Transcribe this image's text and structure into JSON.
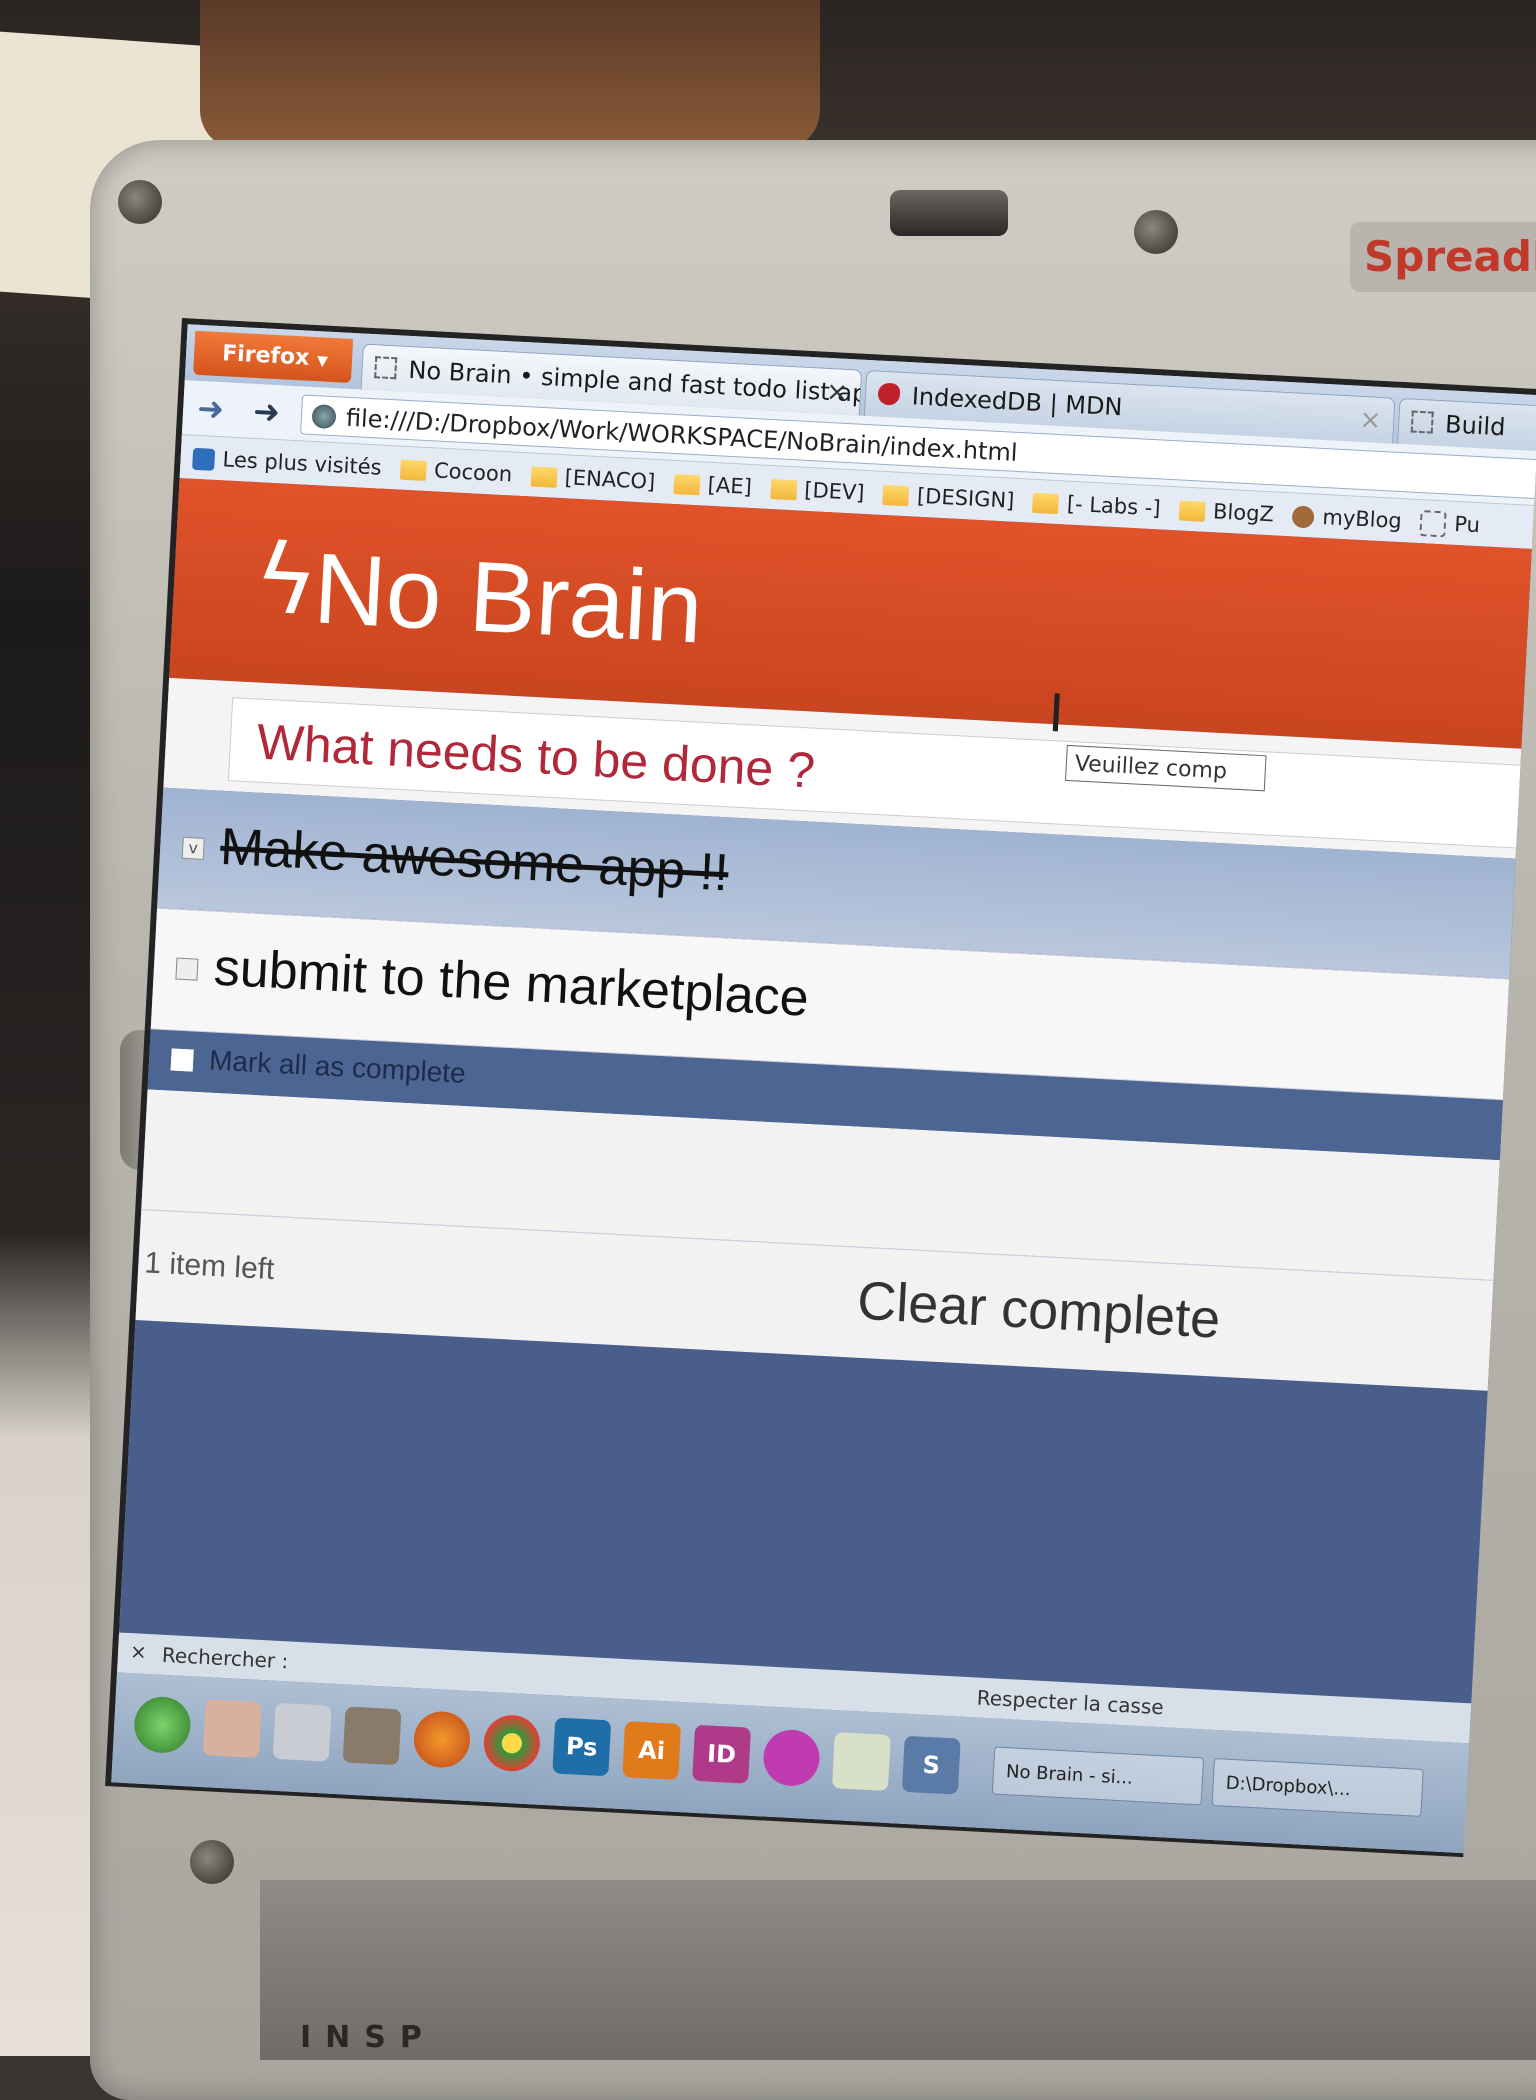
{
  "badge": {
    "brand": "SpreadFi"
  },
  "keyboard": {
    "brand": "INSP"
  },
  "browser": {
    "menu_button": "Firefox",
    "tabs": [
      {
        "label": "No Brain • simple and fast todo list app",
        "close": "×"
      },
      {
        "label": "IndexedDB | MDN",
        "close": "×"
      },
      {
        "label": "Build"
      }
    ],
    "url": "file:///D:/Dropbox/Work/WORKSPACE/NoBrain/index.html",
    "bookmarks": [
      "Les plus visités",
      "Cocoon",
      "[ENACO]",
      "[AE]",
      "[DEV]",
      "[DESIGN]",
      "[- Labs -]",
      "BlogZ",
      "myBlog",
      "Pu"
    ]
  },
  "app": {
    "title": "No Brain",
    "bolt": "ϟ",
    "new_todo_placeholder": "What needs to be done ?",
    "todos": [
      {
        "label": "Make awesome app !!",
        "completed": true,
        "check": "v"
      },
      {
        "label": "submit to the marketplace",
        "completed": false,
        "check": ""
      }
    ],
    "toggle_all_label": "Mark all as complete",
    "items_left": "1 item left",
    "clear_completed": "Clear complete",
    "tooltip": "Veuillez comp",
    "text_cursor": "I"
  },
  "findbar": {
    "close": "×",
    "label": "Rechercher :",
    "match_case": "Respecter la casse"
  },
  "taskbar": {
    "apps": [
      "Ps",
      "Ai",
      "ID",
      "S"
    ],
    "windows": [
      "No Brain - si...",
      "D:\\Dropbox\\..."
    ]
  },
  "colors": {
    "header": "#e0532a",
    "accent_text": "#b0283a",
    "page_bg": "#4a5e8c"
  }
}
